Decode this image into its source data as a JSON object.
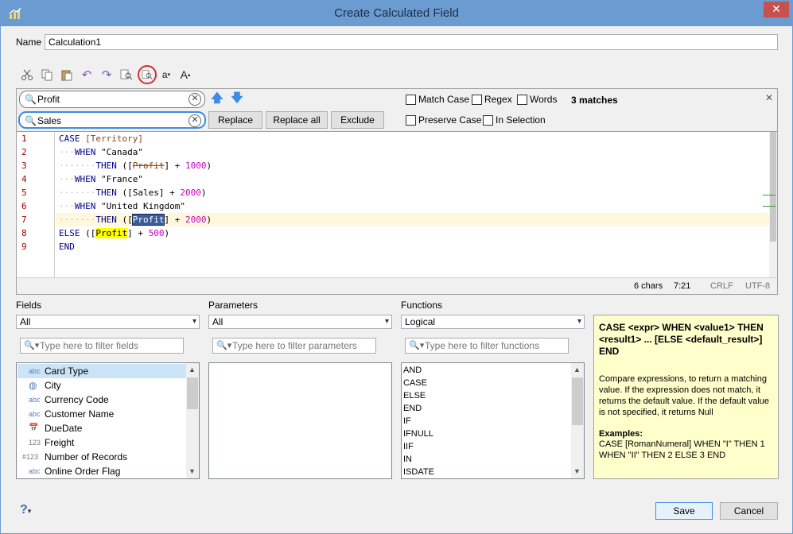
{
  "window": {
    "title": "Create Calculated Field",
    "close_label": "✕"
  },
  "name": {
    "label": "Name",
    "value": "Calculation1"
  },
  "toolbar": {
    "icons": [
      "cut-icon",
      "copy-icon",
      "paste-icon",
      "undo-icon",
      "redo-icon",
      "find-icon",
      "find-replace-icon",
      "decrease-font-icon",
      "increase-font-icon"
    ],
    "font_small": "a",
    "font_large": "A"
  },
  "find": {
    "search_value": "Profit",
    "replace_value": "Sales",
    "replace_label": "Replace",
    "replace_all_label": "Replace all",
    "exclude_label": "Exclude",
    "match_case_label": "Match Case",
    "regex_label": "Regex",
    "words_label": "Words",
    "preserve_case_label": "Preserve Case",
    "in_selection_label": "In Selection",
    "matches": "3 matches",
    "close_label": "✕"
  },
  "editor": {
    "line_numbers": [
      "1",
      "2",
      "3",
      "4",
      "5",
      "6",
      "7",
      "8",
      "9"
    ],
    "tokens": {
      "case": "CASE",
      "territory": "[Territory]",
      "when": "WHEN",
      "then": "THEN",
      "else": "ELSE",
      "end": "END",
      "canada": "\"Canada\"",
      "france": "\"France\"",
      "uk": "\"United Kingdom\"",
      "profit": "Profit",
      "sales": "Sales",
      "n1000": "1000",
      "n2000": "2000",
      "n500": "500"
    },
    "status": {
      "chars": "6 chars",
      "pos": "7:21",
      "eol": "CRLF",
      "encoding": "UTF-8"
    }
  },
  "fields": {
    "label": "Fields",
    "select": "All",
    "filter_placeholder": "Type here to filter fields",
    "items": [
      {
        "icon": "abc",
        "label": "Card Type"
      },
      {
        "icon": "◍",
        "label": "City"
      },
      {
        "icon": "abc",
        "label": "Currency Code"
      },
      {
        "icon": "abc",
        "label": "Customer Name"
      },
      {
        "icon": "📅",
        "label": "DueDate"
      },
      {
        "icon": "123",
        "label": "Freight"
      },
      {
        "icon": "#123",
        "label": "Number of Records"
      },
      {
        "icon": "abc",
        "label": "Online Order Flag"
      }
    ]
  },
  "parameters": {
    "label": "Parameters",
    "select": "All",
    "filter_placeholder": "Type here to filter parameters"
  },
  "functions": {
    "label": "Functions",
    "select": "Logical",
    "filter_placeholder": "Type here to filter functions",
    "items": [
      "AND",
      "CASE",
      "ELSE",
      "END",
      "IF",
      "IFNULL",
      "IIF",
      "IN",
      "ISDATE"
    ]
  },
  "help": {
    "signature": "CASE <expr> WHEN <value1> THEN <result1> ... [ELSE <default_result>] END",
    "description": "Compare expressions, to return a matching value. If the expression does not match, it returns the default value. If the default value is not specified, it returns Null",
    "examples_label": "Examples:",
    "example": "CASE [RomanNumeral] WHEN \"I\" THEN 1 WHEN \"II\" THEN 2 ELSE 3 END"
  },
  "footer": {
    "help_label": "?",
    "save_label": "Save",
    "cancel_label": "Cancel"
  }
}
